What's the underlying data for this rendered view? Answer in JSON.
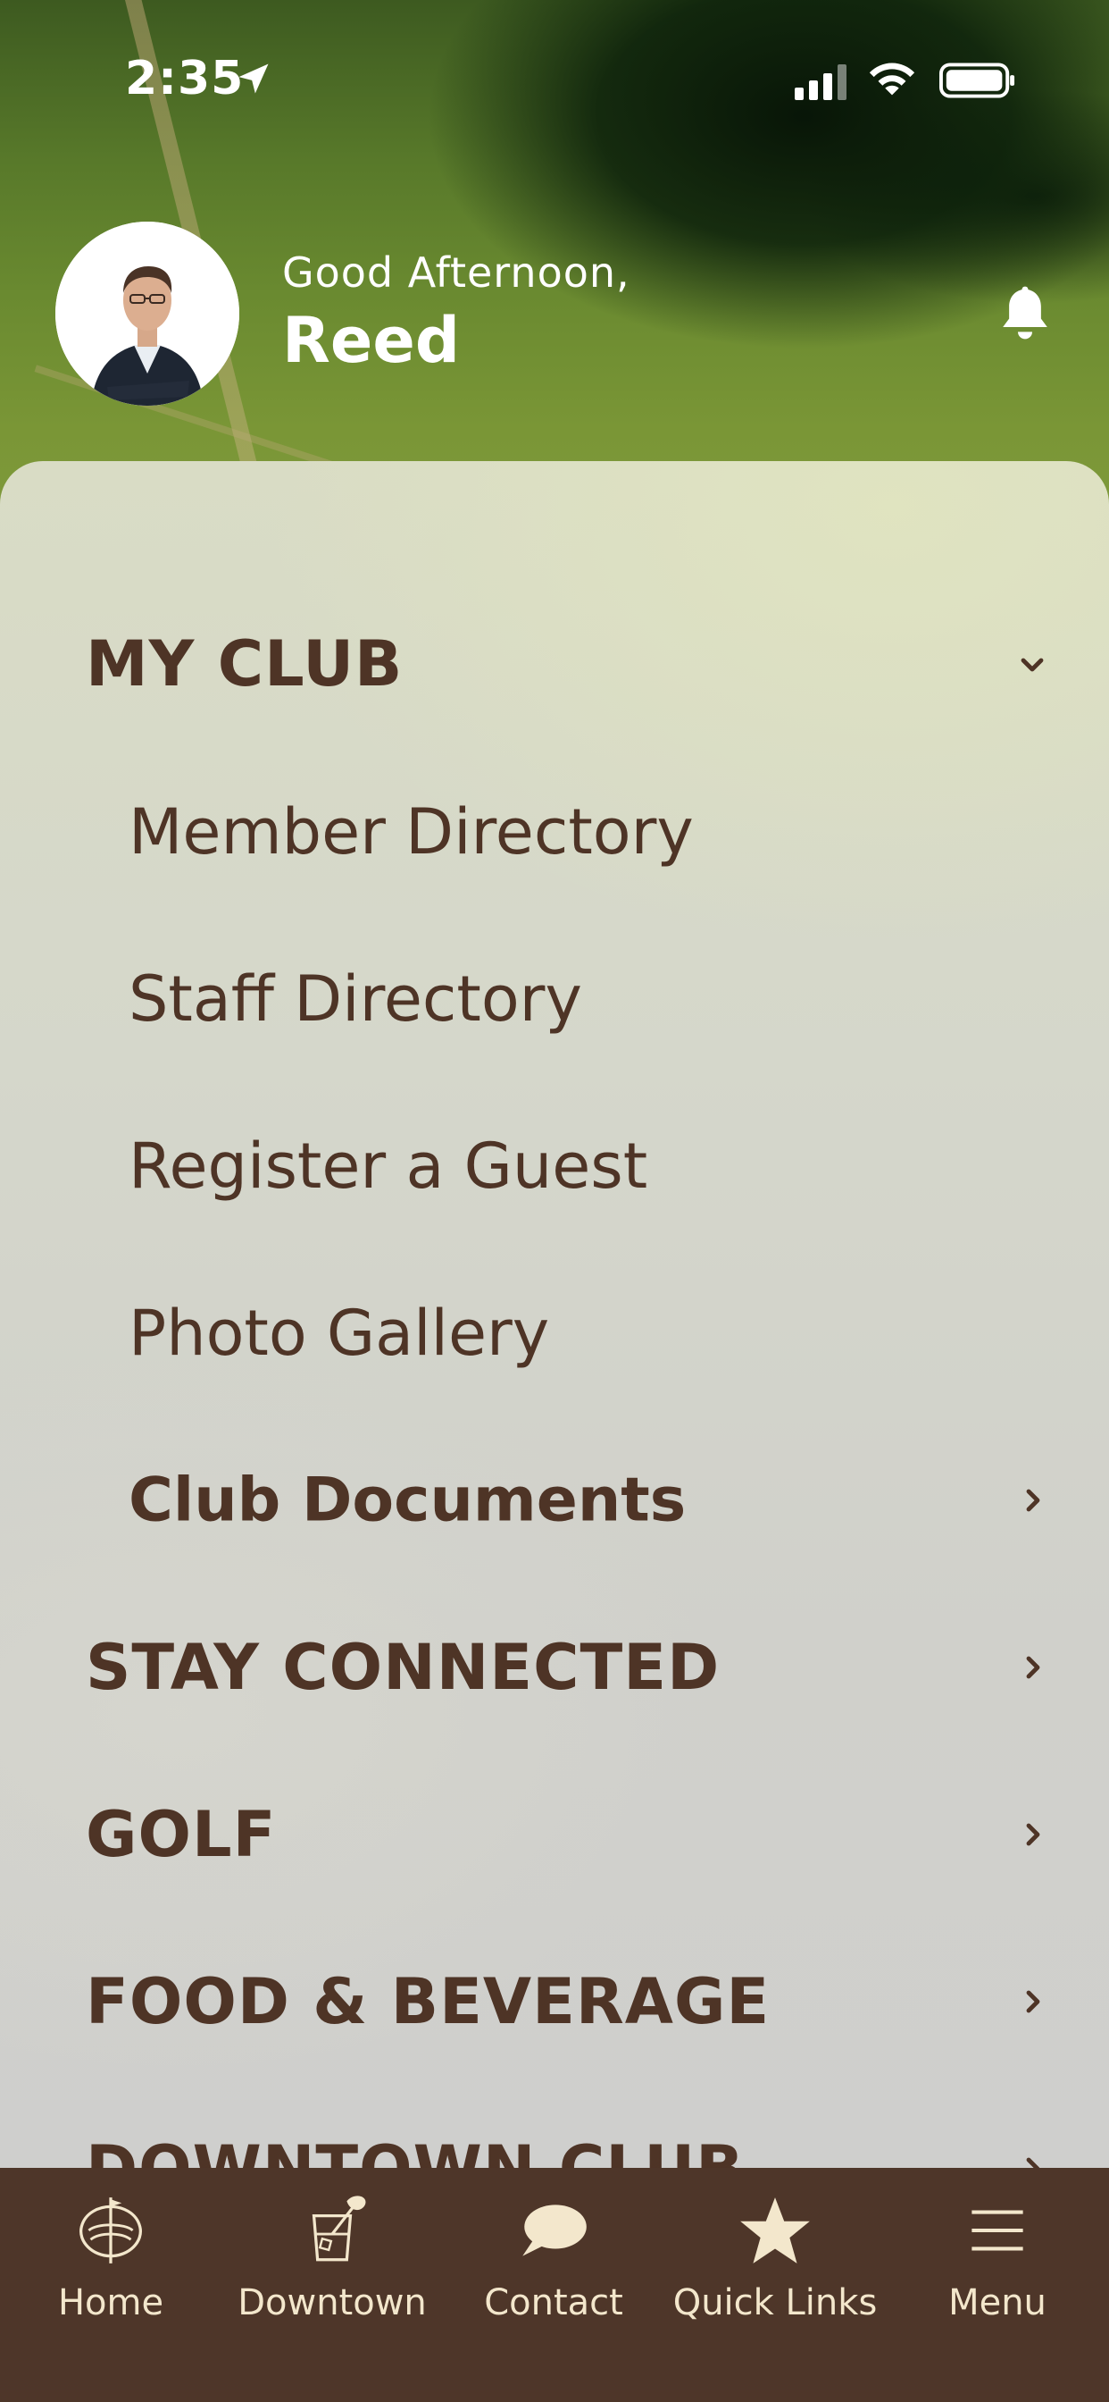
{
  "status_bar": {
    "time": "2:35"
  },
  "header": {
    "greeting": "Good Afternoon,",
    "user_name": "Reed"
  },
  "menu": {
    "sections": [
      {
        "label": "MY CLUB",
        "expanded": true,
        "items": [
          {
            "label": "Member Directory"
          },
          {
            "label": "Staff Directory"
          },
          {
            "label": "Register a Guest"
          },
          {
            "label": "Photo Gallery"
          },
          {
            "label": "Club Documents"
          }
        ]
      },
      {
        "label": "STAY CONNECTED"
      },
      {
        "label": "GOLF"
      },
      {
        "label": "FOOD & BEVERAGE"
      },
      {
        "label": "DOWNTOWN CLUB"
      }
    ]
  },
  "tabbar": {
    "tabs": [
      {
        "label": "Home",
        "icon": "club-crest-icon"
      },
      {
        "label": "Downtown",
        "icon": "cocktail-glass-icon"
      },
      {
        "label": "Contact",
        "icon": "chat-bubble-icon"
      },
      {
        "label": "Quick Links",
        "icon": "star-icon"
      },
      {
        "label": "Menu",
        "icon": "hamburger-menu-icon"
      }
    ]
  },
  "colors": {
    "text_brown": "#4e3426",
    "tabbar_bg": "#4e3629",
    "tab_label": "#f3e7cc"
  }
}
